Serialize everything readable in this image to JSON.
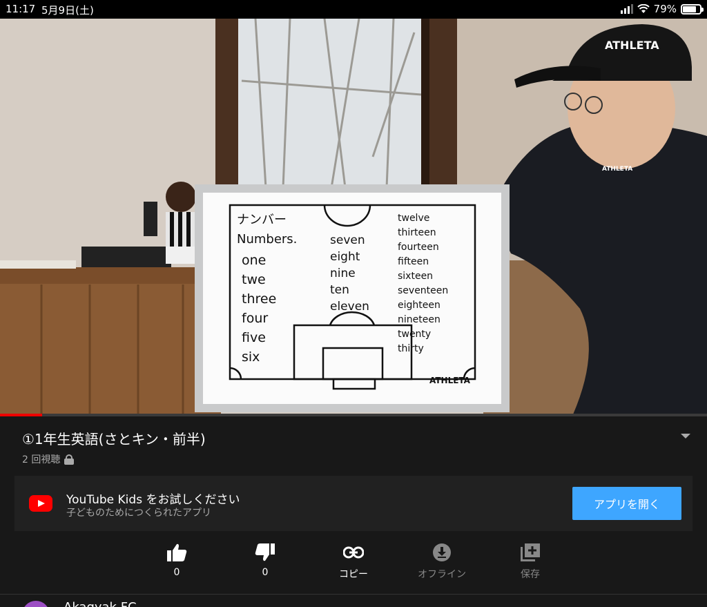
{
  "status_bar": {
    "time": "11:17",
    "date": "5月9日(土)",
    "battery_percent_text": "79%",
    "battery_level": 0.79
  },
  "video": {
    "progress": 0.06,
    "whiteboard": {
      "brand": "ATHLETA",
      "col1": [
        "ナンバー",
        "Numbers.",
        "one",
        "twe",
        "three",
        "four",
        "five",
        "six"
      ],
      "col2": [
        "seven",
        "eight",
        "nine",
        "ten",
        "eleven"
      ],
      "col3": [
        "twelve",
        "thirteen",
        "fourteen",
        "fifteen",
        "sixteen",
        "seventeen",
        "eighteen",
        "nineteen",
        "twenty",
        "thirty"
      ]
    },
    "cap_brand": "ATHLETA",
    "jacket_brand": "ATHLETA"
  },
  "video_info": {
    "title": "①1年生英語(さとキン・前半)",
    "views": "2 回視聴"
  },
  "promo": {
    "heading": "YouTube Kids をお試しください",
    "subtext": "子どものためにつくられたアプリ",
    "button": "アプリを開く"
  },
  "actions": [
    {
      "name": "like",
      "label": "0",
      "icon": "thumbs-up-icon"
    },
    {
      "name": "dislike",
      "label": "0",
      "icon": "thumbs-down-icon"
    },
    {
      "name": "copy",
      "label": "コピー",
      "icon": "link-icon"
    },
    {
      "name": "offline",
      "label": "オフライン",
      "icon": "download-icon"
    },
    {
      "name": "save",
      "label": "保存",
      "icon": "add-playlist-icon"
    }
  ],
  "channel": {
    "name": "Akagyak FC"
  },
  "colors": {
    "accent_button": "#3ea6ff",
    "progress_red": "#e00000",
    "youtube_red": "#ff0000"
  }
}
